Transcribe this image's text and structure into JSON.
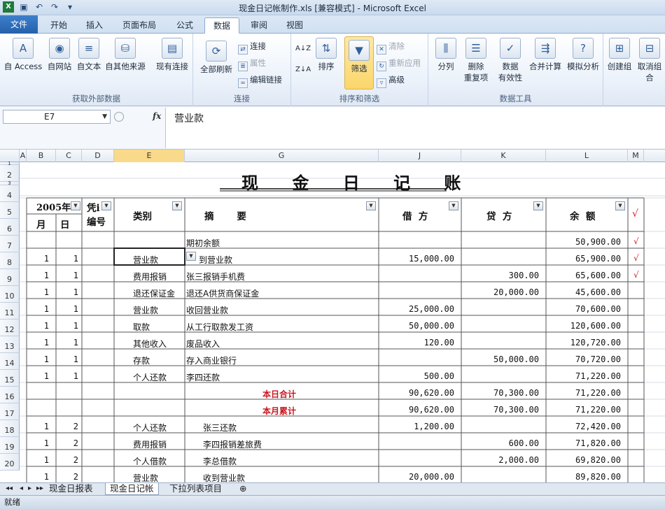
{
  "window": {
    "title": "现金日记帐制作.xls  [兼容模式]  -  Microsoft Excel"
  },
  "tabs": [
    "文件",
    "开始",
    "插入",
    "页面布局",
    "公式",
    "数据",
    "审阅",
    "视图"
  ],
  "ribbon": {
    "get_external": {
      "label": "获取外部数据",
      "buttons": [
        "自 Access",
        "自网站",
        "自文本",
        "自其他来源",
        "现有连接"
      ]
    },
    "connections": {
      "label": "连接",
      "refresh_all": "全部刷新",
      "connect": "连接",
      "properties": "属性",
      "edit_links": "编辑链接"
    },
    "sort_filter": {
      "label": "排序和筛选",
      "sort": "排序",
      "filter": "筛选",
      "clear": "清除",
      "reapply": "重新应用",
      "advanced": "高级"
    },
    "data_tools": {
      "label": "数据工具",
      "split": "分列",
      "remove_dup_1": "删除",
      "remove_dup_2": "重复项",
      "validation_1": "数据",
      "validation_2": "有效性",
      "consolidate": "合并计算",
      "whatif": "模拟分析"
    },
    "outline": {
      "group": "创建组",
      "ungroup": "取消组合"
    }
  },
  "formula_bar": {
    "name_box": "E7",
    "fx": "fx",
    "value": "营业款"
  },
  "columns": [
    "A",
    "B",
    "C",
    "D",
    "E",
    "G",
    "J",
    "K",
    "L",
    "M"
  ],
  "rows": [
    "1",
    "2",
    "3",
    "4",
    "5",
    "6",
    "7",
    "8",
    "9",
    "10",
    "11",
    "12",
    "13",
    "14",
    "15",
    "16",
    "17",
    "18",
    "19",
    "20"
  ],
  "sheet_title": "现 金 日 记 账",
  "headers": {
    "year": "2005年",
    "month": "月",
    "day": "日",
    "voucher_1": "凭i",
    "voucher_2": "编号",
    "category": "类别",
    "summary": "摘       要",
    "debit": "借  方",
    "credit": "贷  方",
    "balance": "余  额",
    "check": "√"
  },
  "table_rows": [
    {
      "month": "",
      "day": "",
      "cat": "",
      "summary": "期初余额",
      "debit": "",
      "credit": "",
      "balance": "50,900.00",
      "check": "√"
    },
    {
      "month": "1",
      "day": "1",
      "cat": "营业款",
      "summary": "到营业款",
      "debit": "15,000.00",
      "credit": "",
      "balance": "65,900.00",
      "check": "√"
    },
    {
      "month": "1",
      "day": "1",
      "cat": "费用报销",
      "summary": "张三报销手机费",
      "debit": "",
      "credit": "300.00",
      "balance": "65,600.00",
      "check": "√"
    },
    {
      "month": "1",
      "day": "1",
      "cat": "退还保证金",
      "summary": "退还A供货商保证金",
      "debit": "",
      "credit": "20,000.00",
      "balance": "45,600.00",
      "check": ""
    },
    {
      "month": "1",
      "day": "1",
      "cat": "营业款",
      "summary": "收回营业款",
      "debit": "25,000.00",
      "credit": "",
      "balance": "70,600.00",
      "check": ""
    },
    {
      "month": "1",
      "day": "1",
      "cat": "取款",
      "summary": "从工行取款发工资",
      "debit": "50,000.00",
      "credit": "",
      "balance": "120,600.00",
      "check": ""
    },
    {
      "month": "1",
      "day": "1",
      "cat": "其他收入",
      "summary": "废品收入",
      "debit": "120.00",
      "credit": "",
      "balance": "120,720.00",
      "check": ""
    },
    {
      "month": "1",
      "day": "1",
      "cat": "存款",
      "summary": "存入商业银行",
      "debit": "",
      "credit": "50,000.00",
      "balance": "70,720.00",
      "check": ""
    },
    {
      "month": "1",
      "day": "1",
      "cat": "个人还款",
      "summary": "李四还款",
      "debit": "500.00",
      "credit": "",
      "balance": "71,220.00",
      "check": ""
    },
    {
      "month": "",
      "day": "",
      "cat": "",
      "summary": "本日合计",
      "debit": "90,620.00",
      "credit": "70,300.00",
      "balance": "71,220.00",
      "check": ""
    },
    {
      "month": "",
      "day": "",
      "cat": "",
      "summary": "本月累计",
      "debit": "90,620.00",
      "credit": "70,300.00",
      "balance": "71,220.00",
      "check": ""
    },
    {
      "month": "1",
      "day": "2",
      "cat": "个人还款",
      "summary": "张三还款",
      "debit": "1,200.00",
      "credit": "",
      "balance": "72,420.00",
      "check": ""
    },
    {
      "month": "1",
      "day": "2",
      "cat": "费用报销",
      "summary": "李四报销差旅费",
      "debit": "",
      "credit": "600.00",
      "balance": "71,820.00",
      "check": ""
    },
    {
      "month": "1",
      "day": "2",
      "cat": "个人借款",
      "summary": "李总借款",
      "debit": "",
      "credit": "2,000.00",
      "balance": "69,820.00",
      "check": ""
    },
    {
      "month": "1",
      "day": "2",
      "cat": "营业款",
      "summary": "收到营业款",
      "debit": "20,000.00",
      "credit": "",
      "balance": "89,820.00",
      "check": ""
    }
  ],
  "sheet_tabs": [
    "现金日报表",
    "现金日记帐",
    "下拉列表项目"
  ],
  "status": "就绪"
}
